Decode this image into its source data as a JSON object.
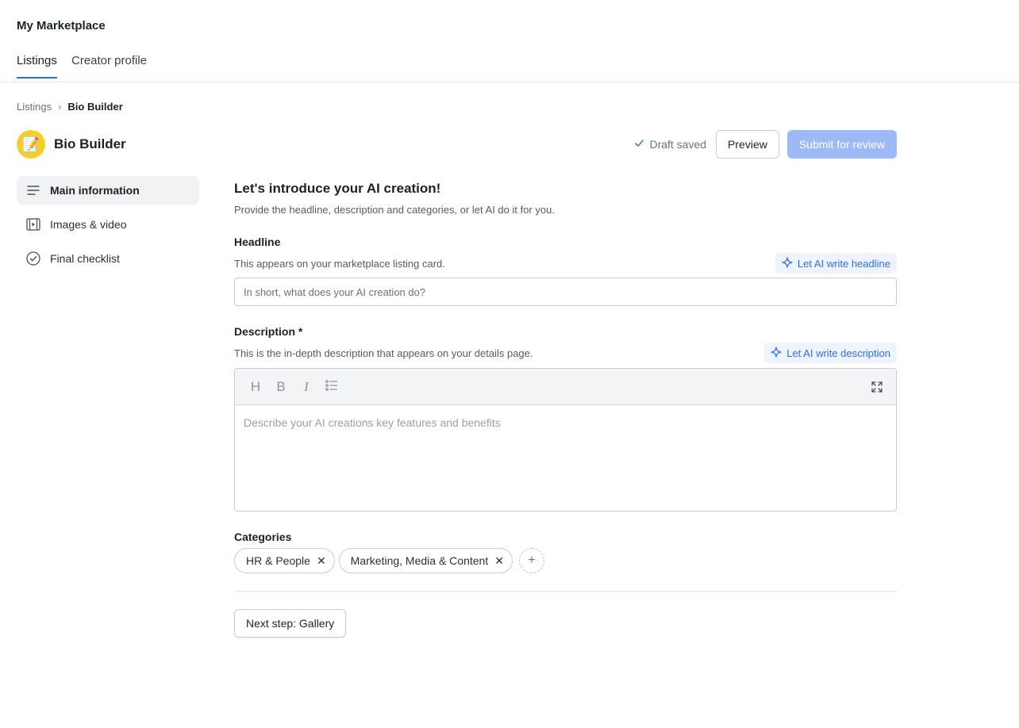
{
  "app": {
    "title": "My Marketplace"
  },
  "tabs": [
    {
      "label": "Listings",
      "active": true
    },
    {
      "label": "Creator profile",
      "active": false
    }
  ],
  "breadcrumb": {
    "parent": "Listings",
    "separator": "›",
    "current": "Bio Builder"
  },
  "listing": {
    "name": "Bio Builder",
    "avatar_emoji": "📝"
  },
  "header": {
    "draft_status": "Draft saved",
    "preview_label": "Preview",
    "submit_label": "Submit for review"
  },
  "sidebar": {
    "items": [
      {
        "label": "Main information",
        "icon": "lines-icon",
        "active": true
      },
      {
        "label": "Images & video",
        "icon": "film-icon",
        "active": false
      },
      {
        "label": "Final checklist",
        "icon": "check-circle-icon",
        "active": false
      }
    ]
  },
  "main": {
    "title": "Let's introduce your AI creation!",
    "subtitle": "Provide the headline, description and categories, or let AI do it for you.",
    "headline": {
      "label": "Headline",
      "help": "This appears on your marketplace listing card.",
      "ai_button": "Let AI write headline",
      "placeholder": "In short, what does your AI creation do?",
      "value": ""
    },
    "description": {
      "label": "Description *",
      "help": "This is the in-depth description that appears on your details page.",
      "ai_button": "Let AI write description",
      "placeholder": "Describe your AI creations key features and benefits",
      "toolbar": {
        "heading": "H",
        "bold": "B",
        "italic": "I"
      }
    },
    "categories": {
      "label": "Categories",
      "items": [
        "HR & People",
        "Marketing, Media & Content"
      ],
      "remove_glyph": "✕",
      "add_glyph": "+"
    },
    "next_button": "Next step: Gallery"
  },
  "colors": {
    "accent": "#2f6fe4",
    "submit_disabled": "#9dbaf6",
    "avatar_bg": "#f5cf27",
    "success": "#2e9b55"
  }
}
